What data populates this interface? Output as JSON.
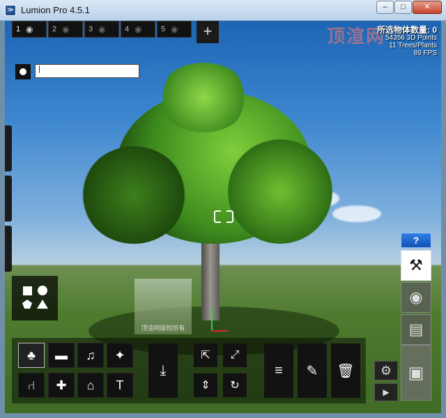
{
  "window": {
    "title": "Lumion Pro 4.5.1",
    "minimize": "–",
    "maximize": "□",
    "close": "✕"
  },
  "layers": [
    {
      "num": "1",
      "active": true
    },
    {
      "num": "2",
      "active": false
    },
    {
      "num": "3",
      "active": false
    },
    {
      "num": "4",
      "active": false
    },
    {
      "num": "5",
      "active": false
    }
  ],
  "add_layer": "+",
  "stats": {
    "selected": "所选物体数量: 0",
    "points": "54356 3D Points",
    "trees": "11 Trees/Plants",
    "fps": "89 FPS"
  },
  "watermark": "顶渲网",
  "name_input": {
    "value": "|"
  },
  "thumb_label": "顶渲网版权所有",
  "categories": [
    {
      "icon": "tree-icon",
      "glyph": "♣"
    },
    {
      "icon": "car-icon",
      "glyph": "▬"
    },
    {
      "icon": "music-icon",
      "glyph": "♫"
    },
    {
      "icon": "effects-icon",
      "glyph": "✦"
    },
    {
      "icon": "chair-icon",
      "glyph": "⑁"
    },
    {
      "icon": "person-icon",
      "glyph": "✚"
    },
    {
      "icon": "house-icon",
      "glyph": "⌂"
    },
    {
      "icon": "tools-icon",
      "glyph": "T"
    }
  ],
  "place_icon": "⤓",
  "tools": [
    "⇱",
    "⤢",
    "⇕",
    "↻"
  ],
  "actions": [
    "≡",
    "✎",
    "🗑"
  ],
  "help": "?",
  "modes": [
    "⚒",
    "◉",
    "▤"
  ],
  "settings": "⚙",
  "play": "▶",
  "save": "▣"
}
